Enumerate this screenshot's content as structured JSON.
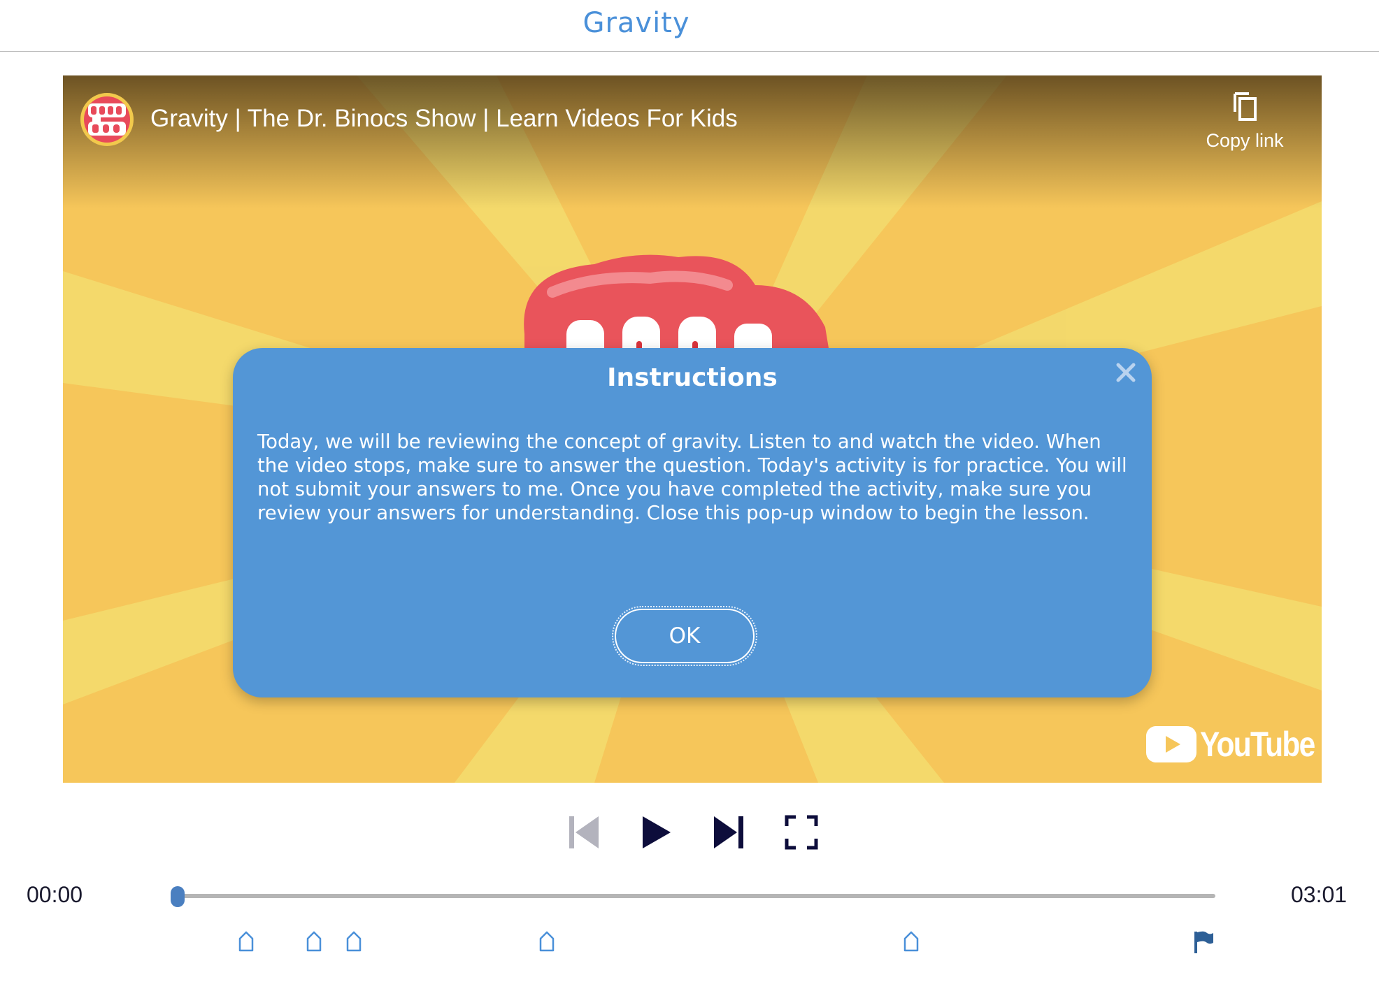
{
  "page": {
    "title": "Gravity"
  },
  "video": {
    "title": "Gravity | The Dr. Binocs Show | Learn Videos For Kids",
    "channel_logo_text": "Peek a boo",
    "copy_link_label": "Copy link",
    "youtube_label": "YouTube",
    "background_logo_text": "PEEK"
  },
  "modal": {
    "title": "Instructions",
    "body": "Today, we will be reviewing the concept of gravity. Listen to and watch the video. When the video stops, make sure to answer the question. Today's activity is for practice. You will not submit your answers to me. Once you have completed the activity, make sure you review your answers for understanding. Close this pop-up window to begin the lesson.",
    "ok_label": "OK",
    "close_icon": "close-icon"
  },
  "controls": {
    "icons": [
      "skip-back-icon",
      "play-icon",
      "skip-forward-icon",
      "fullscreen-icon"
    ],
    "current_time": "00:00",
    "duration": "03:01",
    "progress": 0
  },
  "markers": {
    "icons": [
      "question-marker-icon",
      "question-marker-icon",
      "question-marker-icon",
      "question-marker-icon",
      "question-marker-icon",
      "end-flag-icon"
    ]
  },
  "colors": {
    "title_blue": "#4a90d9",
    "modal_blue": "#5396d6",
    "control_dark": "#0d0d3b",
    "disabled_gray": "#b3b3bd",
    "thumb_blue": "#4a7fc0",
    "flag_blue": "#2d5f96"
  }
}
